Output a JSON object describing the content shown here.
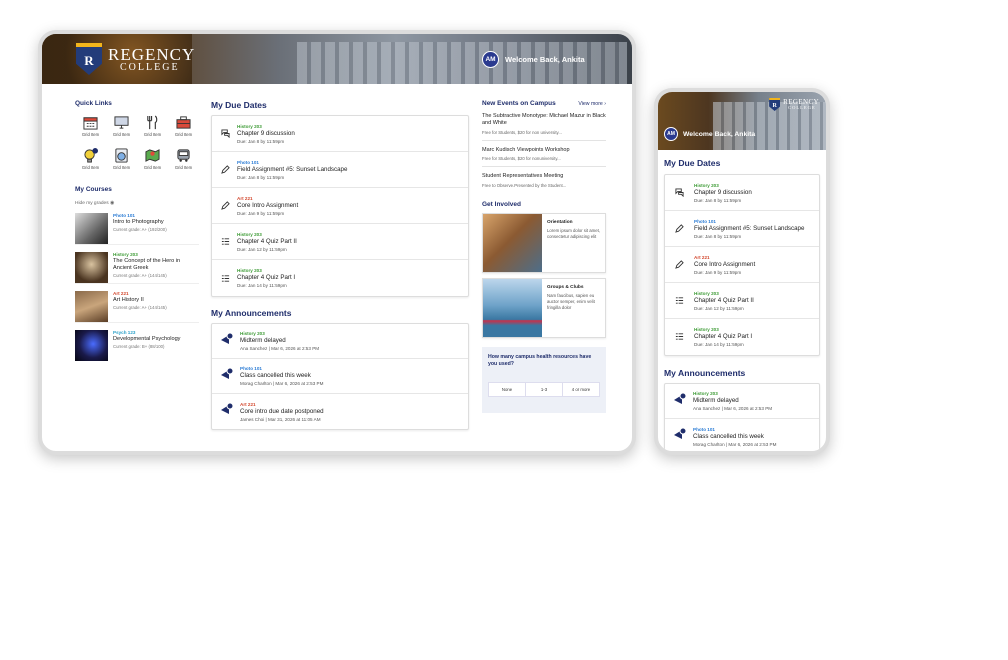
{
  "brand": {
    "line1": "REGENCY",
    "line2": "COLLEGE",
    "shield_letter": "R",
    "color": "#1f2d6b",
    "accent": "#f2b51c"
  },
  "user": {
    "initials": "AM",
    "welcome": "Welcome Back, Ankita"
  },
  "quick_links": {
    "title": "Quick Links",
    "items": [
      {
        "label": "Grid Item",
        "icon": "calendar-icon"
      },
      {
        "label": "Grid Item",
        "icon": "monitor-icon"
      },
      {
        "label": "Grid Item",
        "icon": "utensils-icon"
      },
      {
        "label": "Grid Item",
        "icon": "toolbox-icon"
      },
      {
        "label": "Grid Item",
        "icon": "lightbulb-icon",
        "badge": "New"
      },
      {
        "label": "Grid Item",
        "icon": "laundry-icon"
      },
      {
        "label": "Grid Item",
        "icon": "map-icon"
      },
      {
        "label": "Grid Item",
        "icon": "bus-icon"
      }
    ]
  },
  "courses": {
    "title": "My Courses",
    "hide_grades": "Hide my grades",
    "items": [
      {
        "tag": "Photo 101",
        "tag_color": "#2a7bd4",
        "name": "Intro to Photography",
        "grade": "Current grade: A+ (192/200)"
      },
      {
        "tag": "History 203",
        "tag_color": "#3d9b35",
        "name": "The Concept of the Hero in Ancient Greek",
        "grade": "Current grade: A+ (144/145)"
      },
      {
        "tag": "Art 221",
        "tag_color": "#d2452b",
        "name": "Art History II",
        "grade": "Current grade: A+ (144/145)"
      },
      {
        "tag": "Psych 123",
        "tag_color": "#2aa0c8",
        "name": "Developmental Psychology",
        "grade": "Current grade: B+ (88/100)"
      }
    ]
  },
  "due_dates": {
    "title": "My Due Dates",
    "items": [
      {
        "tag": "History 203",
        "tag_color": "#3d9b35",
        "title": "Chapter 9 discussion",
        "due": "Due: Jan 8 by 11:59pm",
        "icon": "discussion-icon"
      },
      {
        "tag": "Photo 101",
        "tag_color": "#2a7bd4",
        "title": "Field Assignment #5: Sunset Landscape",
        "due": "Due: Jan 8 by 11:59pm",
        "icon": "pencil-icon"
      },
      {
        "tag": "Art 221",
        "tag_color": "#d2452b",
        "title": "Core Intro Assignment",
        "due": "Due: Jan 9 by 11:59pm",
        "icon": "pencil-icon"
      },
      {
        "tag": "History 203",
        "tag_color": "#3d9b35",
        "title": "Chapter 4 Quiz Part II",
        "due": "Due: Jan 12 by 11:59pm",
        "icon": "quiz-icon"
      },
      {
        "tag": "History 203",
        "tag_color": "#3d9b35",
        "title": "Chapter 4 Quiz Part I",
        "due": "Due: Jan 14 by 11:59pm",
        "icon": "quiz-icon"
      }
    ]
  },
  "announcements": {
    "title": "My Announcements",
    "items": [
      {
        "tag": "History 203",
        "tag_color": "#3d9b35",
        "title": "Midterm delayed",
        "meta": "Ana Sanchez | Mar 6, 2026 at 2:53 PM"
      },
      {
        "tag": "Photo 101",
        "tag_color": "#2a7bd4",
        "title": "Class cancelled this week",
        "meta": "Morag Charlton | Mar 6, 2026 at 2:53 PM"
      },
      {
        "tag": "Art 221",
        "tag_color": "#d2452b",
        "title": "Core intro due date postponed",
        "meta": "James Choi | Mar 31, 2026 at 11:05 AM"
      }
    ]
  },
  "events": {
    "title": "New Events on Campus",
    "view_more": "View more",
    "items": [
      {
        "title": "The Subtractive Monotype: Michael Mazur in Black and White",
        "sub": "Free for Students, $20 for non university..."
      },
      {
        "title": "Marc Kudisch Viewpoints Workshop",
        "sub": "Free for Students, $20 for nonuniversity..."
      },
      {
        "title": "Student Representatives Meeting",
        "sub": "Free to Observe.Presented by the Student..."
      }
    ]
  },
  "get_involved": {
    "title": "Get Involved",
    "items": [
      {
        "title": "Orientation",
        "text": "Lorem ipsum dolor sit amet, consectetur adipiscing elit"
      },
      {
        "title": "Groups & Clubs",
        "text": "Nam faucibus, sapien eu auctor semper, enim velit fringilla dolor"
      }
    ]
  },
  "poll": {
    "question": "How many campus health resources have you used?",
    "options": [
      "None",
      "1-3",
      "4 or more"
    ]
  },
  "phone": {
    "announcements": [
      {
        "tag": "History 203",
        "tag_color": "#3d9b35",
        "title": "Midterm delayed",
        "meta": "Ana Sanchez | Mar 6, 2026 at 2:53 PM"
      },
      {
        "tag": "Photo 101",
        "tag_color": "#2a7bd4",
        "title": "Class cancelled this week",
        "meta": "Morag Charlton | Mar 6, 2026 at 2:53 PM"
      }
    ]
  }
}
